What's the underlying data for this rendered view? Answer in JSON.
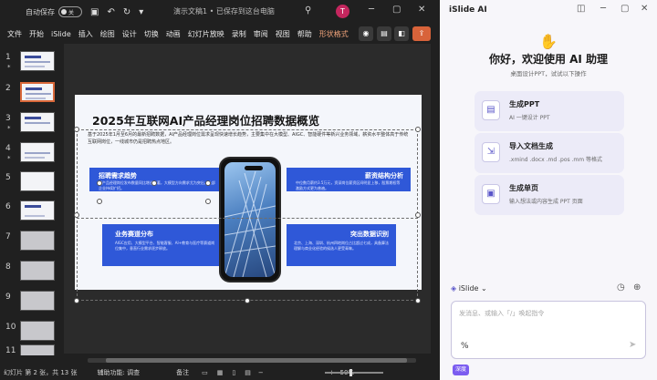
{
  "titlebar": {
    "autosave_label": "自动保存",
    "toggle_state": "关",
    "doc_title": "演示文稿1 • 已保存到这台电脑",
    "avatar_letter": "T"
  },
  "ribbon": {
    "tabs": [
      "文件",
      "开始",
      "iSlide",
      "插入",
      "绘图",
      "设计",
      "切换",
      "动画",
      "幻灯片放映",
      "录制",
      "审阅",
      "视图",
      "帮助",
      "形状格式"
    ]
  },
  "thumbnails": [
    {
      "num": "1",
      "star": "*"
    },
    {
      "num": "2",
      "star": ""
    },
    {
      "num": "3",
      "star": "*"
    },
    {
      "num": "4",
      "star": "*"
    },
    {
      "num": "5",
      "star": ""
    },
    {
      "num": "6",
      "star": ""
    },
    {
      "num": "7",
      "star": ""
    },
    {
      "num": "8",
      "star": ""
    },
    {
      "num": "9",
      "star": ""
    },
    {
      "num": "10",
      "star": ""
    },
    {
      "num": "11",
      "star": ""
    }
  ],
  "slide": {
    "title": "2025年互联网AI产品经理岗位招聘数据概览",
    "intro": "基于2025年1月至6月的最新招聘数据，AI产品经理岗位需求呈现快速增长趋势，主要集中在大模型、AIGC、智能硬件等新兴业务领域，薪资水平整体高于传统互联网岗位，一线城市仍是招聘热点地区。",
    "sections": {
      "left_top": {
        "label": "招聘需求趋势",
        "text": "AI产品经理岗位发布数量同比增长显著，大模型方向需求尤为突出，头部企业持续扩招。"
      },
      "right_top": {
        "label": "薪资结构分析",
        "text": "中位数月薪约3.5万元，资深岗位薪资区间明显上移，股票期权等激励方式更为普遍。"
      },
      "left_bot": {
        "label": "业务赛道分布",
        "text": "AIGC应用、大模型平台、智能客服、AI+教育与医疗等赛道岗位集中，垂直行业需求逐步释放。"
      },
      "right_bot": {
        "label": "突出数据识别",
        "text": "北京、上海、深圳、杭州四地岗位占比超过七成，具备算法理解与商业化经验的候选人更受青睐。"
      }
    }
  },
  "statusbar": {
    "slide_info": "幻灯片 第 2 张，共 13 张",
    "accessibility": "辅助功能: 调查",
    "notes": "备注",
    "zoom": "50%"
  },
  "islide": {
    "title": "iSlide AI",
    "greeting": "你好，欢迎使用 AI 助理",
    "subtitle": "桌面设计PPT，试试以下操作",
    "cards": [
      {
        "title": "生成PPT",
        "desc": "AI 一键设计 PPT",
        "icon": "presentation-icon"
      },
      {
        "title": "导入文档生成",
        "desc": ".xmind .docx .md .pos .mm 等格式",
        "icon": "document-import-icon"
      },
      {
        "title": "生成单页",
        "desc": "输入想法或内容生成 PPT 页面",
        "icon": "single-page-icon"
      }
    ],
    "model": "iSlide",
    "input_placeholder": "发消息、或输入「/」唤起指令",
    "input_prefix": "%",
    "tag": "深度"
  }
}
